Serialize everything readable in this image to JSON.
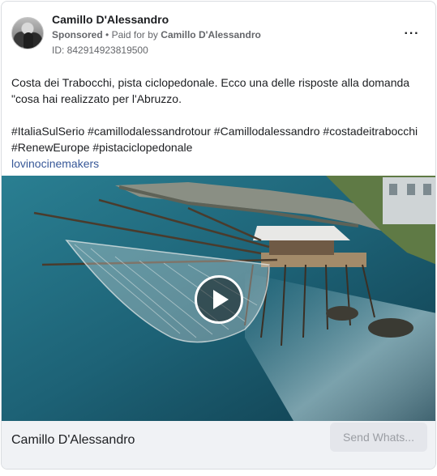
{
  "post": {
    "page_name": "Camillo D'Alessandro",
    "sponsored_label": "Sponsored",
    "separator": "•",
    "paid_for_by": "Paid for by",
    "payer": "Camillo D'Alessandro",
    "ad_id": "ID: 842914923819500",
    "more_icon": "more-horizontal-icon",
    "more_label": "···"
  },
  "content": {
    "line1": "Costa dei Trabocchi, pista ciclopedonale. Ecco una delle risposte alla domanda \"cosa hai realizzato per l'Abruzzo.",
    "hashtags_line1": "#ItaliaSulSerio #camillodalessandrotour #Camillodalessandro #costadeitrabocchi",
    "hashtags_line2": "#RenewEurope #pistaciclopedonale",
    "credit": "lovinocinemakers"
  },
  "media": {
    "type": "video",
    "play_icon": "play-icon"
  },
  "footer": {
    "title": "Camillo D'Alessandro",
    "cta_label": "Send Whats..."
  },
  "colors": {
    "link": "#385898",
    "footer_bg": "#f0f2f5",
    "cta_bg": "#e4e6eb",
    "secondary_text": "#65676b"
  }
}
